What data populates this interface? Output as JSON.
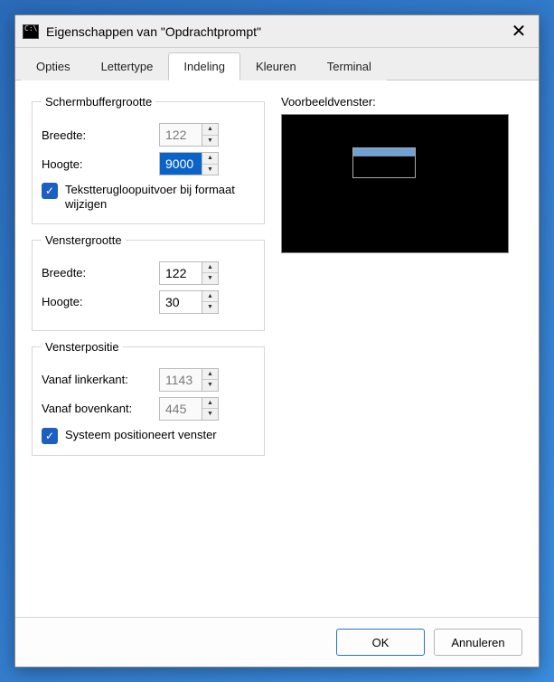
{
  "window": {
    "title": "Eigenschappen van \"Opdrachtprompt\""
  },
  "tabs": {
    "opties": "Opties",
    "lettertype": "Lettertype",
    "indeling": "Indeling",
    "kleuren": "Kleuren",
    "terminal": "Terminal"
  },
  "groups": {
    "schermbuffer": {
      "legend": "Schermbuffergrootte",
      "breedte_label": "Breedte:",
      "breedte_value": "122",
      "hoogte_label": "Hoogte:",
      "hoogte_value": "9000",
      "wrap_label": "Tekstterugloopuitvoer bij formaat wijzigen"
    },
    "venstergrootte": {
      "legend": "Venstergrootte",
      "breedte_label": "Breedte:",
      "breedte_value": "122",
      "hoogte_label": "Hoogte:",
      "hoogte_value": "30"
    },
    "vensterpositie": {
      "legend": "Vensterpositie",
      "links_label": "Vanaf linkerkant:",
      "links_value": "1143",
      "boven_label": "Vanaf bovenkant:",
      "boven_value": "445",
      "systeem_label": "Systeem positioneert venster"
    }
  },
  "preview_label": "Voorbeeldvenster:",
  "footer": {
    "ok": "OK",
    "cancel": "Annuleren"
  }
}
